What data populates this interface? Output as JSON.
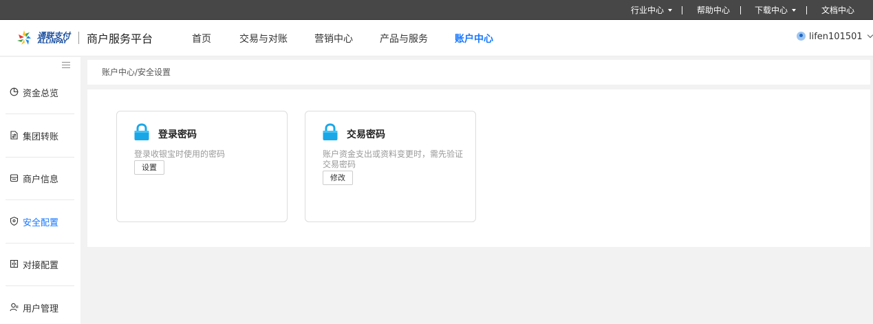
{
  "topbar": {
    "industry": "行业中心",
    "help": "帮助中心",
    "download": "下载中心",
    "docs": "文档中心"
  },
  "header": {
    "logo_cn": "通联支付",
    "logo_en": "ALLINPAY",
    "platform": "商户服务平台",
    "nav": [
      "首页",
      "交易与对账",
      "营销中心",
      "产品与服务",
      "账户中心"
    ],
    "active_nav": "账户中心",
    "username": "lifen101501",
    "accent_color": "#1677ff"
  },
  "sidebar": {
    "items": [
      {
        "label": "资金总览",
        "icon": "pie-chart-icon"
      },
      {
        "label": "集团转账",
        "icon": "file-transfer-icon"
      },
      {
        "label": "商户信息",
        "icon": "shop-icon"
      },
      {
        "label": "安全配置",
        "icon": "shield-icon"
      },
      {
        "label": "对接配置",
        "icon": "integration-icon"
      },
      {
        "label": "用户管理",
        "icon": "user-manage-icon"
      }
    ],
    "active_item": "安全配置"
  },
  "breadcrumb": "账户中心/安全设置",
  "cards": [
    {
      "title": "登录密码",
      "desc": "登录收银宝时使用的密码",
      "button": "设置",
      "icon": "lock-icon"
    },
    {
      "title": "交易密码",
      "desc": "账户资金支出或资料变更时，需先验证交易密码",
      "button": "修改",
      "icon": "lock-icon"
    }
  ]
}
